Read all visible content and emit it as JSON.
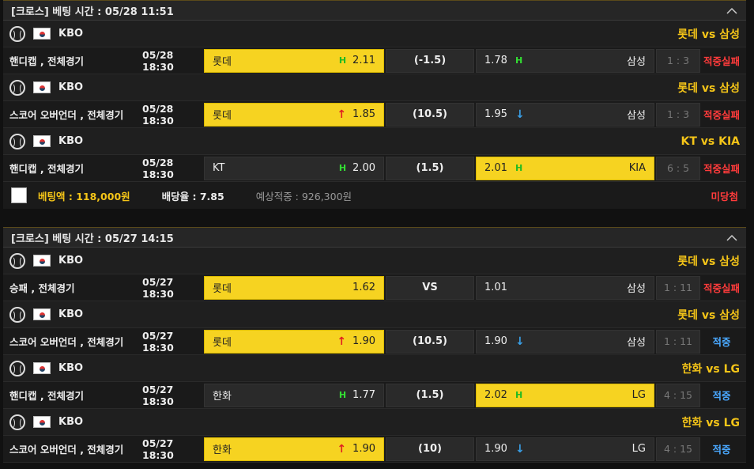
{
  "slips": [
    {
      "title": "[크로스] 베팅 시간 : 05/28 11:51",
      "bets": [
        {
          "league": "KBO",
          "teams": "롯데 vs 삼성",
          "type": "핸디캡 , 전체경기",
          "time": "05/28 18:30",
          "home": "롯데",
          "home_mark": "H",
          "home_odds": "2.11",
          "mid": "(-1.5)",
          "away_odds": "1.78",
          "away_mark": "H",
          "away": "삼성",
          "score": "1 : 3",
          "result": "적중실패",
          "sel": "home",
          "rtype": "fail"
        },
        {
          "league": "KBO",
          "teams": "롯데 vs 삼성",
          "type": "스코어 오버언더 , 전체경기",
          "time": "05/28 18:30",
          "home": "롯데",
          "home_mark": "↑",
          "home_odds": "1.85",
          "mid": "(10.5)",
          "away_odds": "1.95",
          "away_mark": "↓",
          "away": "삼성",
          "score": "1 : 3",
          "result": "적중실패",
          "sel": "home",
          "rtype": "fail"
        },
        {
          "league": "KBO",
          "teams": "KT vs KIA",
          "type": "핸디캡 , 전체경기",
          "time": "05/28 18:30",
          "home": "KT",
          "home_mark": "H",
          "home_odds": "2.00",
          "mid": "(1.5)",
          "away_odds": "2.01",
          "away_mark": "H",
          "away": "KIA",
          "score": "6 : 5",
          "result": "적중실패",
          "sel": "away",
          "rtype": "fail"
        }
      ],
      "summary": {
        "amount": "베팅액 : 118,000원",
        "rate": "배당율 : 7.85",
        "expect": "예상적중 : 926,300원",
        "status": "미당첨"
      }
    },
    {
      "title": "[크로스] 베팅 시간 : 05/27 14:15",
      "bets": [
        {
          "league": "KBO",
          "teams": "롯데 vs 삼성",
          "type": "승패 , 전체경기",
          "time": "05/27 18:30",
          "home": "롯데",
          "home_mark": "",
          "home_odds": "1.62",
          "mid": "VS",
          "away_odds": "1.01",
          "away_mark": "",
          "away": "삼성",
          "score": "1 : 11",
          "result": "적중실패",
          "sel": "home",
          "rtype": "fail"
        },
        {
          "league": "KBO",
          "teams": "롯데 vs 삼성",
          "type": "스코어 오버언더 , 전체경기",
          "time": "05/27 18:30",
          "home": "롯데",
          "home_mark": "↑",
          "home_odds": "1.90",
          "mid": "(10.5)",
          "away_odds": "1.90",
          "away_mark": "↓",
          "away": "삼성",
          "score": "1 : 11",
          "result": "적중",
          "sel": "home",
          "rtype": "hit"
        },
        {
          "league": "KBO",
          "teams": "한화 vs LG",
          "type": "핸디캡 , 전체경기",
          "time": "05/27 18:30",
          "home": "한화",
          "home_mark": "H",
          "home_odds": "1.77",
          "mid": "(1.5)",
          "away_odds": "2.02",
          "away_mark": "H",
          "away": "LG",
          "score": "4 : 15",
          "result": "적중",
          "sel": "away",
          "rtype": "hit"
        },
        {
          "league": "KBO",
          "teams": "한화 vs LG",
          "type": "스코어 오버언더 , 전체경기",
          "time": "05/27 18:30",
          "home": "한화",
          "home_mark": "↑",
          "home_odds": "1.90",
          "mid": "(10)",
          "away_odds": "1.90",
          "away_mark": "↓",
          "away": "LG",
          "score": "4 : 15",
          "result": "적중",
          "sel": "home",
          "rtype": "hit"
        }
      ]
    }
  ],
  "icons": {
    "collapse": "chevron-up-icon",
    "sport": "baseball-icon",
    "flag": "korea-flag-icon"
  },
  "colors": {
    "accent": "#f6d321",
    "title": "#f5c518",
    "fail": "#ff3b3b",
    "hit": "#4aa8ff"
  }
}
